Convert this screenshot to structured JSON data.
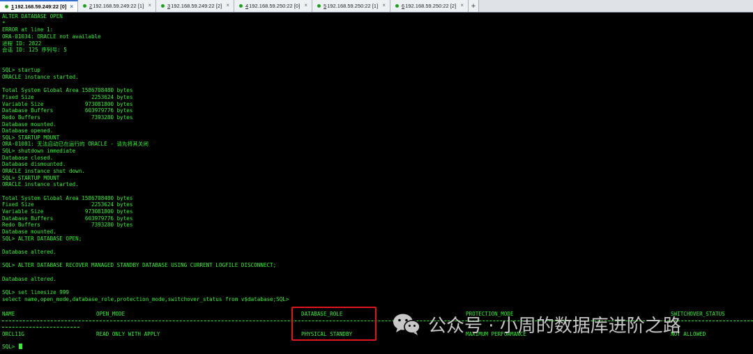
{
  "tabs": [
    {
      "num": "1",
      "label": " 192.168.59.249:22 [0]",
      "active": true
    },
    {
      "num": "2",
      "label": " 192.168.59.249:22 [1]",
      "active": false
    },
    {
      "num": "3",
      "label": " 192.168.59.249:22 [2]",
      "active": false
    },
    {
      "num": "4",
      "label": " 192.168.59.250:22 [0]",
      "active": false
    },
    {
      "num": "5",
      "label": " 192.168.59.250:22 [1]",
      "active": false
    },
    {
      "num": "6",
      "label": " 192.168.59.250:22 [2]",
      "active": false
    }
  ],
  "tab_close": "×",
  "add_tab": "+",
  "terminal": {
    "lines": [
      "ALTER DATABASE OPEN",
      "*",
      "ERROR at line 1:",
      "ORA-01034: ORACLE not available",
      "进程 ID: 2822",
      "会话 ID: 125 序列号: 5",
      "",
      "",
      "SQL> startup",
      "ORACLE instance started.",
      "",
      "Total System Global Area 1586708480 bytes",
      "Fixed Size                  2253624 bytes",
      "Variable Size             973081800 bytes",
      "Database Buffers          603979776 bytes",
      "Redo Buffers                7393280 bytes",
      "Database mounted.",
      "Database opened.",
      "SQL> STARTUP MOUNT",
      "ORA-01081: 无法启动已在运行的 ORACLE - 请先将其关闭",
      "SQL> shutdown immediate",
      "Database closed.",
      "Database dismounted.",
      "ORACLE instance shut down.",
      "SQL> STARTUP MOUNT",
      "ORACLE instance started.",
      "",
      "Total System Global Area 1586708480 bytes",
      "Fixed Size                  2253624 bytes",
      "Variable Size             973081800 bytes",
      "Database Buffers          603979776 bytes",
      "Redo Buffers                7393280 bytes",
      "Database mounted.",
      "SQL> ALTER DATABASE OPEN;",
      "",
      "Database altered.",
      "",
      "SQL> ALTER DATABASE RECOVER MANAGED STANDBY DATABASE USING CURRENT LOGFILE DISCONNECT;",
      "",
      "Database altered.",
      "",
      "SQL> set linesize 999",
      "select name,open_mode,database_role,protection_mode,switchover_status from v$database;SQL>"
    ],
    "prompt": "SQL> "
  },
  "result_table": {
    "headers": [
      "NAME",
      "OPEN_MODE",
      "DATABASE_ROLE",
      "PROTECTION_MODE",
      "SWITCHOVER_STATUS"
    ],
    "values": [
      "ORCL11G",
      "READ ONLY WITH APPLY",
      "PHYSICAL STANDBY",
      "MAXIMUM PERFORMANCE",
      "NOT ALLOWED"
    ]
  },
  "watermark": {
    "text": "公众号 · 小周的数据库进阶之路",
    "icon": "wechat-icon"
  },
  "colors": {
    "terminal_fg": "#2ff22f",
    "terminal_bg": "#000000",
    "highlight_border": "#e0161c"
  }
}
